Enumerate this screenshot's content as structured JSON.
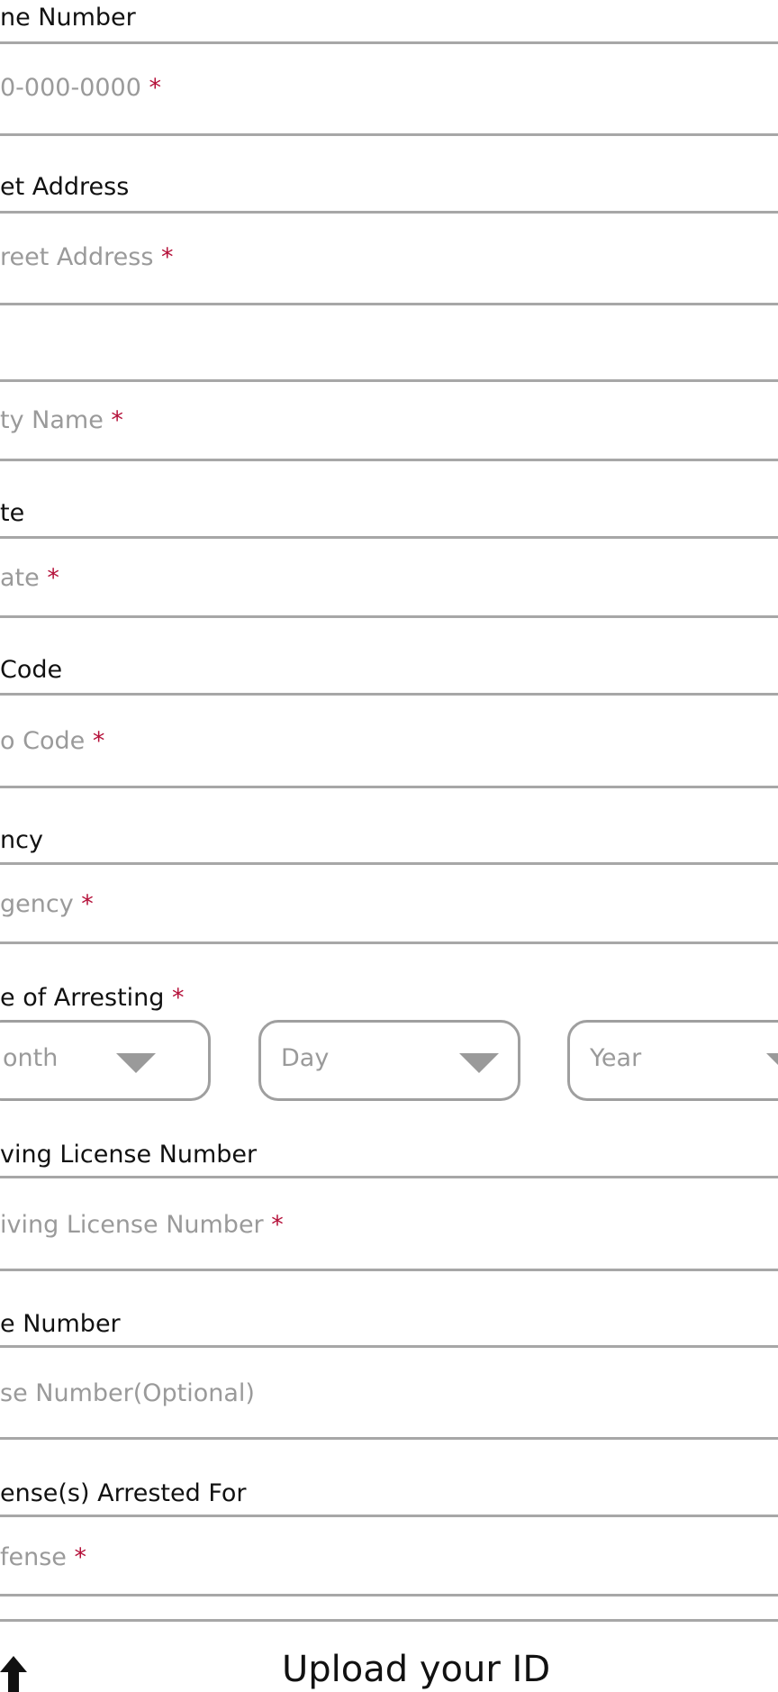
{
  "form": {
    "phone": {
      "label": "ne Number",
      "placeholder": "0-000-0000 ",
      "required": "*"
    },
    "street": {
      "label": "et Address",
      "placeholder": "reet Address ",
      "required": "*"
    },
    "city": {
      "placeholder": "ty Name ",
      "required": "*"
    },
    "state": {
      "label": "te",
      "placeholder": "ate ",
      "required": "*"
    },
    "zip": {
      "label": "Code",
      "placeholder": "o Code ",
      "required": "*"
    },
    "agency": {
      "label": "ncy",
      "placeholder": "gency ",
      "required": "*"
    },
    "arrest_date": {
      "label": "e of Arresting ",
      "required": "*",
      "month": "onth",
      "day": "Day",
      "year": "Year"
    },
    "license": {
      "label": "ving License Number",
      "placeholder": "iving License Number ",
      "required": "*"
    },
    "case": {
      "label": "e Number",
      "placeholder": "se Number(Optional)"
    },
    "offense": {
      "label": "ense(s) Arrested For",
      "placeholder": "fense ",
      "required": "*"
    }
  },
  "upload": {
    "title": "Upload your ID",
    "icon": "upload-arrow-icon"
  }
}
